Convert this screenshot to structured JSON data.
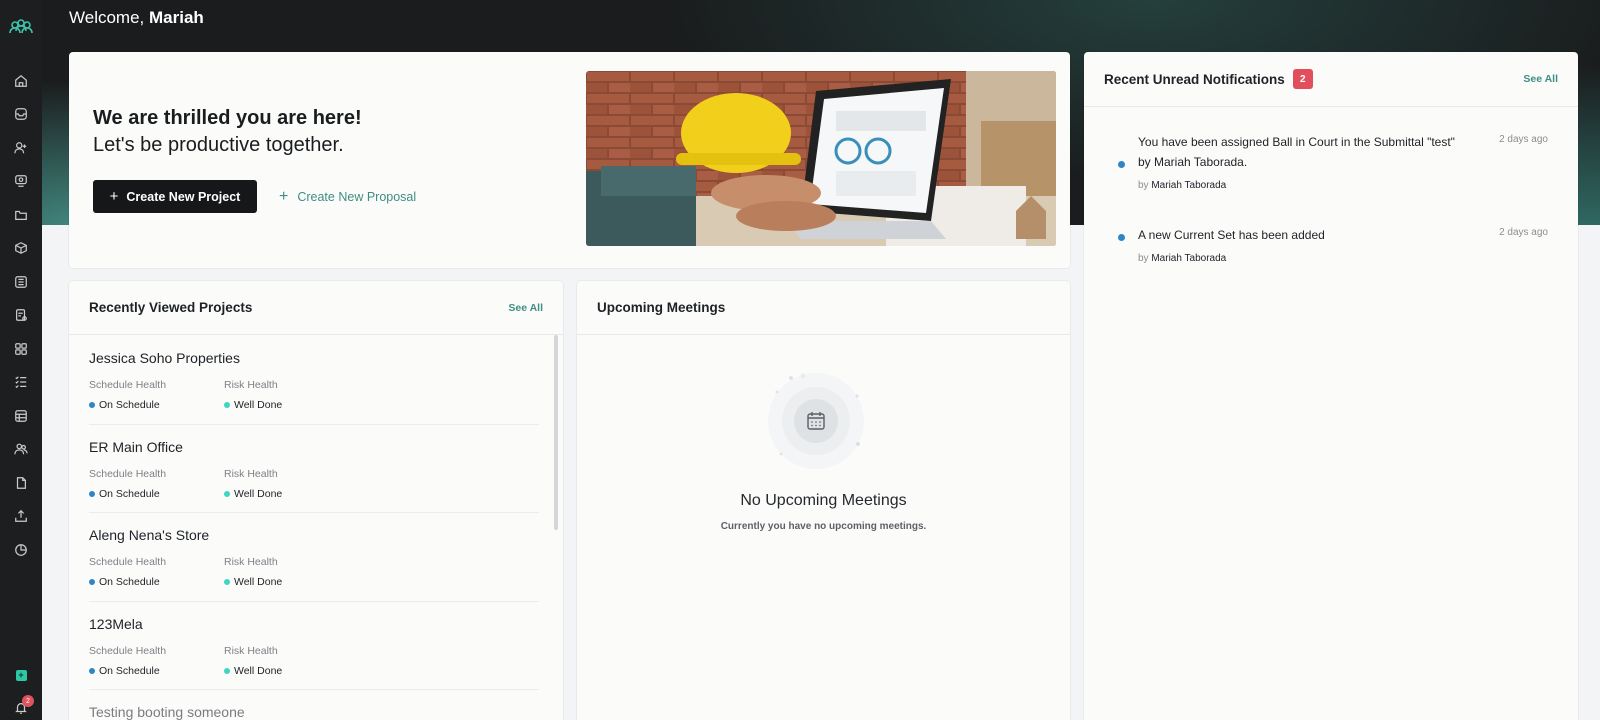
{
  "colors": {
    "accent": "#3f8e84",
    "sidebar_bg": "#1c1e20",
    "badge": "#e14f5c",
    "on_schedule_dot": "#2f86c5",
    "well_done_dot": "#3ed6c0",
    "notif_dot": "#2f86c5"
  },
  "header": {
    "welcome_prefix": "Welcome,",
    "user_name": "Mariah"
  },
  "sidebar": {
    "logo_icon": "team-logo-icon",
    "items": [
      {
        "icon": "home-icon"
      },
      {
        "icon": "inbox-icon"
      },
      {
        "icon": "user-add-icon"
      },
      {
        "icon": "monitor-icon"
      },
      {
        "icon": "folder-icon"
      },
      {
        "icon": "cube-icon"
      },
      {
        "icon": "list-document-icon"
      },
      {
        "icon": "report-icon"
      },
      {
        "icon": "grid-icon"
      },
      {
        "icon": "checklist-icon"
      },
      {
        "icon": "table-icon"
      },
      {
        "icon": "users-icon"
      },
      {
        "icon": "file-icon"
      },
      {
        "icon": "upload-icon"
      },
      {
        "icon": "pie-chart-icon"
      }
    ],
    "bell_count": "2"
  },
  "hero": {
    "title": "We are thrilled you are here!",
    "subtitle": "Let's be productive together.",
    "create_project_label": "Create New Project",
    "create_proposal_label": "Create New Proposal"
  },
  "recent_projects": {
    "title": "Recently Viewed Projects",
    "see_all": "See All",
    "schedule_label": "Schedule Health",
    "risk_label": "Risk Health",
    "projects": [
      {
        "name": "Jessica Soho Properties",
        "schedule": "On Schedule",
        "risk": "Well Done"
      },
      {
        "name": "ER Main Office",
        "schedule": "On Schedule",
        "risk": "Well Done"
      },
      {
        "name": "Aleng Nena's Store",
        "schedule": "On Schedule",
        "risk": "Well Done"
      },
      {
        "name": "123Mela",
        "schedule": "On Schedule",
        "risk": "Well Done"
      }
    ],
    "partial_project": "Testing booting someone"
  },
  "meetings": {
    "title": "Upcoming Meetings",
    "empty_title": "No Upcoming Meetings",
    "empty_subtitle": "Currently you have no upcoming meetings."
  },
  "notifications": {
    "title": "Recent Unread Notifications",
    "count": "2",
    "see_all": "See All",
    "by_prefix": "by",
    "items": [
      {
        "text": "You have been assigned Ball in Court in the Submittal \"test\" by Mariah Taborada.",
        "time": "2 days ago",
        "by": "Mariah Taborada"
      },
      {
        "text": "A new Current Set has been added",
        "time": "2 days ago",
        "by": "Mariah Taborada"
      }
    ]
  }
}
